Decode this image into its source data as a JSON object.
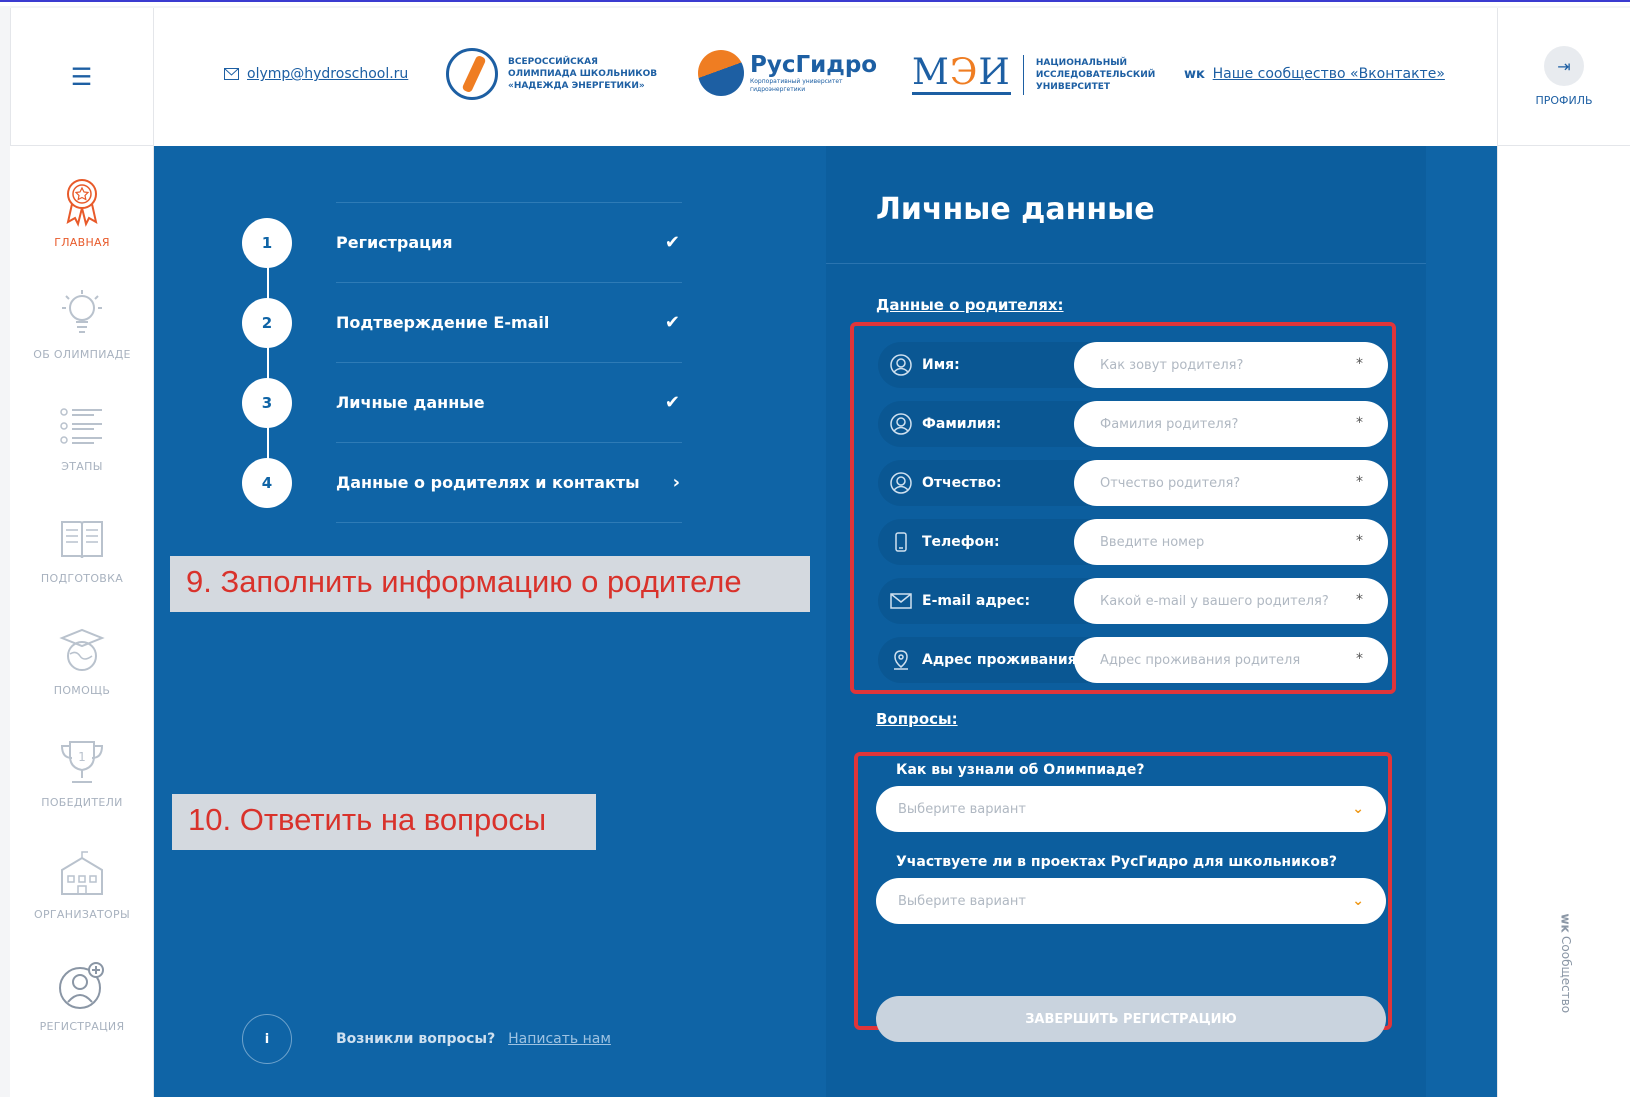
{
  "header": {
    "email": "olymp@hydroschool.ru",
    "logo1_text": "ВСЕРОССИЙСКАЯ ОЛИМПИАДА ШКОЛЬНИКОВ «НАДЕЖДА ЭНЕРГЕТИКИ»",
    "logo2_name": "РусГидро",
    "logo2_sub": "Корпоративный университет гидроэнергетики",
    "logo3_mark": "МЭИ",
    "logo3_text": "НАЦИОНАЛЬНЫЙ ИССЛЕДОВАТЕЛЬСКИЙ УНИВЕРСИТЕТ",
    "vk_text": "Наше сообщество «Вконтакте»",
    "profile_label": "ПРОФИЛЬ"
  },
  "sidebar": {
    "items": [
      {
        "label": "ГЛАВНАЯ",
        "icon": "medal-icon"
      },
      {
        "label": "ОБ ОЛИМПИАДЕ",
        "icon": "lightbulb-icon"
      },
      {
        "label": "ЭТАПЫ",
        "icon": "list-icon"
      },
      {
        "label": "ПОДГОТОВКА",
        "icon": "book-icon"
      },
      {
        "label": "ПОМОЩЬ",
        "icon": "graduation-globe-icon"
      },
      {
        "label": "ПОБЕДИТЕЛИ",
        "icon": "trophy-icon"
      },
      {
        "label": "ОРГАНИЗАТОРЫ",
        "icon": "building-icon"
      },
      {
        "label": "РЕГИСТРАЦИЯ",
        "icon": "user-add-icon"
      }
    ]
  },
  "right_sidebar": {
    "community_label": "Сообщество"
  },
  "steps": [
    {
      "num": "1",
      "label": "Регистрация",
      "mark": "✔"
    },
    {
      "num": "2",
      "label": "Подтверждение E-mail",
      "mark": "✔"
    },
    {
      "num": "3",
      "label": "Личные данные",
      "mark": "✔"
    },
    {
      "num": "4",
      "label": "Данные о родителях и контакты",
      "mark": "›"
    }
  ],
  "annotations": {
    "a1": "9. Заполнить информацию о родителе",
    "a2": "10. Ответить на вопросы"
  },
  "help": {
    "text": "Возникли вопросы?",
    "link": "Написать нам"
  },
  "form": {
    "title": "Личные данные",
    "parents_section": "Данные о родителях:",
    "fields": [
      {
        "label": "Имя:",
        "placeholder": "Как зовут родителя?",
        "icon": "person-icon"
      },
      {
        "label": "Фамилия:",
        "placeholder": "Фамилия родителя?",
        "icon": "person-icon"
      },
      {
        "label": "Отчество:",
        "placeholder": "Отчество родителя?",
        "icon": "person-icon"
      },
      {
        "label": "Телефон:",
        "placeholder": "Введите номер",
        "icon": "phone-icon"
      },
      {
        "label": "E-mail адрес:",
        "placeholder": "Какой e-mail у вашего родителя?",
        "icon": "mail-icon"
      },
      {
        "label": "Адрес проживания:",
        "placeholder": "Адрес проживания родителя",
        "icon": "location-icon"
      }
    ],
    "required_mark": "*",
    "questions_section": "Вопросы:",
    "q1": {
      "label": "Как вы узнали об Олимпиаде?",
      "value": "Выберите вариант"
    },
    "q2": {
      "label": "Участвуете ли в проектах РусГидро для школьников?",
      "value": "Выберите вариант"
    },
    "submit": "ЗАВЕРШИТЬ РЕГИСТРАЦИЮ"
  },
  "colors": {
    "accent": "#0f64a6",
    "active_nav": "#e85a2a",
    "annotation_red": "#d9322b",
    "box_red": "#e0353a"
  }
}
